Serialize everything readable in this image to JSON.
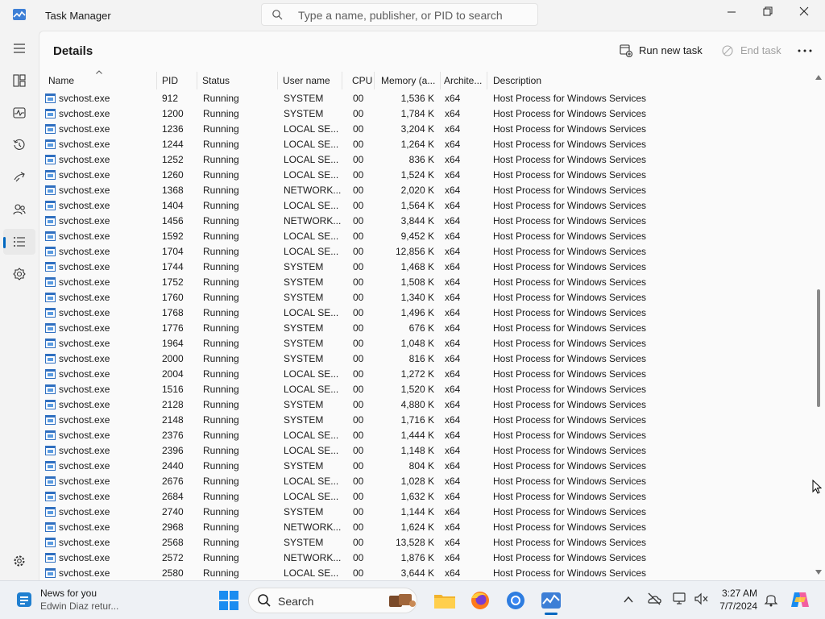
{
  "window": {
    "title": "Task Manager"
  },
  "search": {
    "placeholder": "Type a name, publisher, or PID to search"
  },
  "sidebar": {
    "items": [
      "menu-icon",
      "processes-icon",
      "performance-icon",
      "app-history-icon",
      "startup-apps-icon",
      "users-icon",
      "details-icon",
      "services-icon",
      "settings-icon"
    ]
  },
  "page": {
    "title": "Details",
    "run_task": "Run new task",
    "end_task": "End task"
  },
  "columns": [
    "Name",
    "PID",
    "Status",
    "User name",
    "CPU",
    "Memory (a...",
    "Archite...",
    "Description"
  ],
  "rows": [
    [
      "svchost.exe",
      "912",
      "Running",
      "SYSTEM",
      "00",
      "1,536 K",
      "x64",
      "Host Process for Windows Services"
    ],
    [
      "svchost.exe",
      "1200",
      "Running",
      "SYSTEM",
      "00",
      "1,784 K",
      "x64",
      "Host Process for Windows Services"
    ],
    [
      "svchost.exe",
      "1236",
      "Running",
      "LOCAL SE...",
      "00",
      "3,204 K",
      "x64",
      "Host Process for Windows Services"
    ],
    [
      "svchost.exe",
      "1244",
      "Running",
      "LOCAL SE...",
      "00",
      "1,264 K",
      "x64",
      "Host Process for Windows Services"
    ],
    [
      "svchost.exe",
      "1252",
      "Running",
      "LOCAL SE...",
      "00",
      "836 K",
      "x64",
      "Host Process for Windows Services"
    ],
    [
      "svchost.exe",
      "1260",
      "Running",
      "LOCAL SE...",
      "00",
      "1,524 K",
      "x64",
      "Host Process for Windows Services"
    ],
    [
      "svchost.exe",
      "1368",
      "Running",
      "NETWORK...",
      "00",
      "2,020 K",
      "x64",
      "Host Process for Windows Services"
    ],
    [
      "svchost.exe",
      "1404",
      "Running",
      "LOCAL SE...",
      "00",
      "1,564 K",
      "x64",
      "Host Process for Windows Services"
    ],
    [
      "svchost.exe",
      "1456",
      "Running",
      "NETWORK...",
      "00",
      "3,844 K",
      "x64",
      "Host Process for Windows Services"
    ],
    [
      "svchost.exe",
      "1592",
      "Running",
      "LOCAL SE...",
      "00",
      "9,452 K",
      "x64",
      "Host Process for Windows Services"
    ],
    [
      "svchost.exe",
      "1704",
      "Running",
      "LOCAL SE...",
      "00",
      "12,856 K",
      "x64",
      "Host Process for Windows Services"
    ],
    [
      "svchost.exe",
      "1744",
      "Running",
      "SYSTEM",
      "00",
      "1,468 K",
      "x64",
      "Host Process for Windows Services"
    ],
    [
      "svchost.exe",
      "1752",
      "Running",
      "SYSTEM",
      "00",
      "1,508 K",
      "x64",
      "Host Process for Windows Services"
    ],
    [
      "svchost.exe",
      "1760",
      "Running",
      "SYSTEM",
      "00",
      "1,340 K",
      "x64",
      "Host Process for Windows Services"
    ],
    [
      "svchost.exe",
      "1768",
      "Running",
      "LOCAL SE...",
      "00",
      "1,496 K",
      "x64",
      "Host Process for Windows Services"
    ],
    [
      "svchost.exe",
      "1776",
      "Running",
      "SYSTEM",
      "00",
      "676 K",
      "x64",
      "Host Process for Windows Services"
    ],
    [
      "svchost.exe",
      "1964",
      "Running",
      "SYSTEM",
      "00",
      "1,048 K",
      "x64",
      "Host Process for Windows Services"
    ],
    [
      "svchost.exe",
      "2000",
      "Running",
      "SYSTEM",
      "00",
      "816 K",
      "x64",
      "Host Process for Windows Services"
    ],
    [
      "svchost.exe",
      "2004",
      "Running",
      "LOCAL SE...",
      "00",
      "1,272 K",
      "x64",
      "Host Process for Windows Services"
    ],
    [
      "svchost.exe",
      "1516",
      "Running",
      "LOCAL SE...",
      "00",
      "1,520 K",
      "x64",
      "Host Process for Windows Services"
    ],
    [
      "svchost.exe",
      "2128",
      "Running",
      "SYSTEM",
      "00",
      "4,880 K",
      "x64",
      "Host Process for Windows Services"
    ],
    [
      "svchost.exe",
      "2148",
      "Running",
      "SYSTEM",
      "00",
      "1,716 K",
      "x64",
      "Host Process for Windows Services"
    ],
    [
      "svchost.exe",
      "2376",
      "Running",
      "LOCAL SE...",
      "00",
      "1,444 K",
      "x64",
      "Host Process for Windows Services"
    ],
    [
      "svchost.exe",
      "2396",
      "Running",
      "LOCAL SE...",
      "00",
      "1,148 K",
      "x64",
      "Host Process for Windows Services"
    ],
    [
      "svchost.exe",
      "2440",
      "Running",
      "SYSTEM",
      "00",
      "804 K",
      "x64",
      "Host Process for Windows Services"
    ],
    [
      "svchost.exe",
      "2676",
      "Running",
      "LOCAL SE...",
      "00",
      "1,028 K",
      "x64",
      "Host Process for Windows Services"
    ],
    [
      "svchost.exe",
      "2684",
      "Running",
      "LOCAL SE...",
      "00",
      "1,632 K",
      "x64",
      "Host Process for Windows Services"
    ],
    [
      "svchost.exe",
      "2740",
      "Running",
      "SYSTEM",
      "00",
      "1,144 K",
      "x64",
      "Host Process for Windows Services"
    ],
    [
      "svchost.exe",
      "2968",
      "Running",
      "NETWORK...",
      "00",
      "1,624 K",
      "x64",
      "Host Process for Windows Services"
    ],
    [
      "svchost.exe",
      "2568",
      "Running",
      "SYSTEM",
      "00",
      "13,528 K",
      "x64",
      "Host Process for Windows Services"
    ],
    [
      "svchost.exe",
      "2572",
      "Running",
      "NETWORK...",
      "00",
      "1,876 K",
      "x64",
      "Host Process for Windows Services"
    ],
    [
      "svchost.exe",
      "2580",
      "Running",
      "LOCAL SE...",
      "00",
      "3,644 K",
      "x64",
      "Host Process for Windows Services"
    ]
  ],
  "taskbar": {
    "news_title": "News for you",
    "news_sub": "Edwin Diaz retur...",
    "search_label": "Search",
    "apps": [
      "windows-start-icon",
      "file-explorer-icon",
      "firefox-icon",
      "chrome-icon",
      "task-manager-icon"
    ],
    "time": "3:27 AM",
    "date": "7/7/2024"
  },
  "colors": {
    "accent": "#0067c0",
    "background": "#f3f3f3",
    "content": "#fafafa"
  }
}
